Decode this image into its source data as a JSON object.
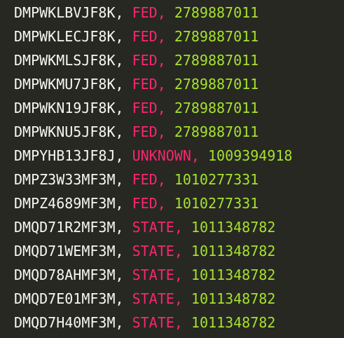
{
  "editor": {
    "separator": ", ",
    "comma": ",",
    "lines": [
      {
        "id": "DMPWKLBVJF8K",
        "kind": "FED",
        "number": "2789887011"
      },
      {
        "id": "DMPWKLECJF8K",
        "kind": "FED",
        "number": "2789887011"
      },
      {
        "id": "DMPWKMLSJF8K",
        "kind": "FED",
        "number": "2789887011"
      },
      {
        "id": "DMPWKMU7JF8K",
        "kind": "FED",
        "number": "2789887011"
      },
      {
        "id": "DMPWKN19JF8K",
        "kind": "FED",
        "number": "2789887011"
      },
      {
        "id": "DMPWKNU5JF8K",
        "kind": "FED",
        "number": "2789887011"
      },
      {
        "id": "DMPYHB13JF8J",
        "kind": "UNKNOWN",
        "number": "1009394918"
      },
      {
        "id": "DMPZ3W33MF3M",
        "kind": "FED",
        "number": "1010277331"
      },
      {
        "id": "DMPZ4689MF3M",
        "kind": "FED",
        "number": "1010277331"
      },
      {
        "id": "DMQD71R2MF3M",
        "kind": "STATE",
        "number": "1011348782"
      },
      {
        "id": "DMQD71WEMF3M",
        "kind": "STATE",
        "number": "1011348782"
      },
      {
        "id": "DMQD78AHMF3M",
        "kind": "STATE",
        "number": "1011348782"
      },
      {
        "id": "DMQD7E01MF3M",
        "kind": "STATE",
        "number": "1011348782"
      },
      {
        "id": "DMQD7H40MF3M",
        "kind": "STATE",
        "number": "1011348782"
      }
    ]
  },
  "colors": {
    "background": "#272822",
    "identifier": "#f8f8f2",
    "keyword": "#f92672",
    "number": "#a6e22e"
  }
}
